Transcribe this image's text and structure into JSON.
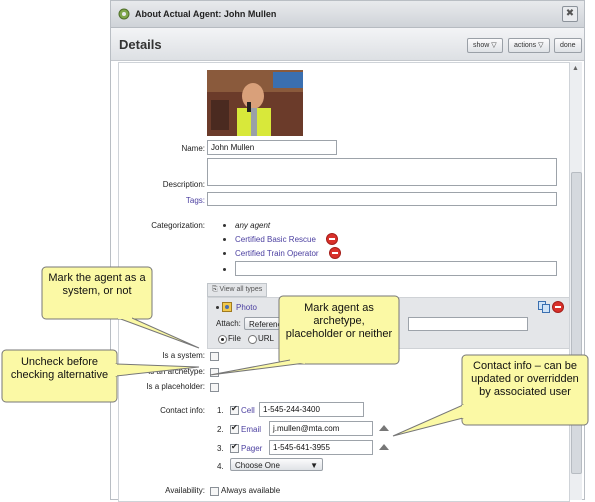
{
  "window": {
    "title": "About Actual Agent: John Mullen",
    "close_glyph": "✖",
    "app_icon": "gear-icon"
  },
  "header": {
    "title": "Details",
    "show_label": "show ▽",
    "actions_label": "actions ▽",
    "done_label": "done"
  },
  "form": {
    "name_label": "Name:",
    "name_value": "John Mullen",
    "description_label": "Description:",
    "description_value": "",
    "tags_label": "Tags:",
    "tags_value": "",
    "categorization_label": "Categorization:",
    "categories": [
      "any agent",
      "Certified Basic Rescue",
      "Certified Train Operator"
    ],
    "view_all_label": "View all types",
    "photo_label": "Photo",
    "attach_label": "Attach:",
    "attach_select": "Referenc",
    "file_label": "File",
    "url_label": "URL",
    "is_system_label": "Is a system:",
    "is_archetype_label": "Is an archetype:",
    "is_placeholder_label": "Is a placeholder:",
    "contact_label": "Contact info:",
    "contacts": [
      {
        "num": "1.",
        "type": "Cell",
        "value": "1-545-244-3400"
      },
      {
        "num": "2.",
        "type": "Email",
        "value": "j.mullen@mta.com"
      },
      {
        "num": "3.",
        "type": "Pager",
        "value": "1-545-641-3955"
      }
    ],
    "contact4_num": "4.",
    "choose_one": "Choose One",
    "availability_label": "Availability:",
    "always_available": "Always available"
  },
  "callouts": {
    "system": "Mark the agent as a system, or not",
    "archetype": "Mark agent as archetype, placeholder or neither",
    "uncheck": "Uncheck before checking alternative",
    "contact": "Contact info – can be updated or overridden by associated user"
  },
  "colors": {
    "callout_fill": "#fbf9a5",
    "link": "#4b3fa0",
    "remove": "#d9312b"
  }
}
